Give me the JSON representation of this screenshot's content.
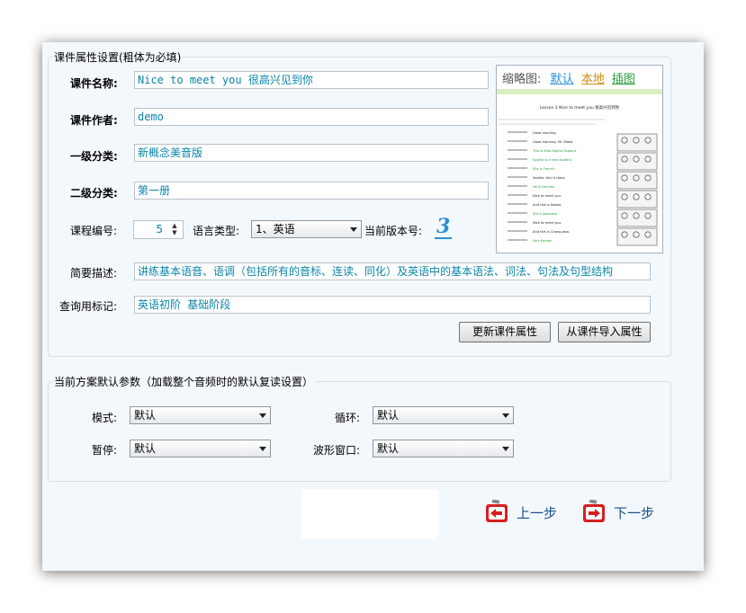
{
  "props_group": {
    "legend": "课件属性设置(粗体为必填)",
    "name_label": "课件名称:",
    "name_value": "Nice to meet you 很高兴见到你",
    "author_label": "课件作者:",
    "author_value": "demo",
    "cat1_label": "一级分类:",
    "cat1_value": "新概念美音版",
    "cat2_label": "二级分类:",
    "cat2_value": "第一册",
    "course_no_label": "课程编号:",
    "course_no_value": "5",
    "lang_label": "语言类型:",
    "lang_value": "1、英语",
    "version_label": "当前版本号:",
    "version_value": "3",
    "desc_label": "简要描述:",
    "desc_value": "讲练基本语音、语调（包括所有的音标、连读、同化）及英语中的基本语法、词法、句法及句型结构",
    "tags_label": "查询用标记:",
    "tags_value": "英语初阶 基础阶段",
    "update_button": "更新课件属性",
    "import_button": "从课件导入属性"
  },
  "thumbnail": {
    "label": "缩略图:",
    "default_link": "默认",
    "local_link": "本地",
    "clipart_link": "插图",
    "preview_title": "Lesson 3  Nice to meet you  很高兴见到你",
    "preview_lines": [
      "Good morning.",
      "Good morning, Mr. Blake.",
      "This is Miss Sophie Dupont.",
      "Sophie is a new student.",
      "She is French.",
      "Sophie, this is Hans.",
      "He is German.",
      "Nice to meet you.",
      "And this is Naoko.",
      "She's Japanese.",
      "Nice to meet you.",
      "And this is Chang-woo.",
      "He's Korean."
    ]
  },
  "defaults_group": {
    "legend": "当前方案默认参数（加载整个音频时的默认复读设置）",
    "mode_label": "模式:",
    "mode_value": "默认",
    "loop_label": "循环:",
    "loop_value": "默认",
    "pause_label": "暂停:",
    "pause_value": "默认",
    "wave_label": "波形窗口:",
    "wave_value": "默认"
  },
  "nav": {
    "prev": "上一步",
    "next": "下一步"
  },
  "colors": {
    "panel_bg": "#f3f8fc",
    "input_text": "#0a84a8",
    "link_blue": "#2a8fd6",
    "link_orange": "#d28a12",
    "link_green": "#2a9a3a",
    "nav_text": "#1a4e8a",
    "nav_icon": "#d42020"
  }
}
